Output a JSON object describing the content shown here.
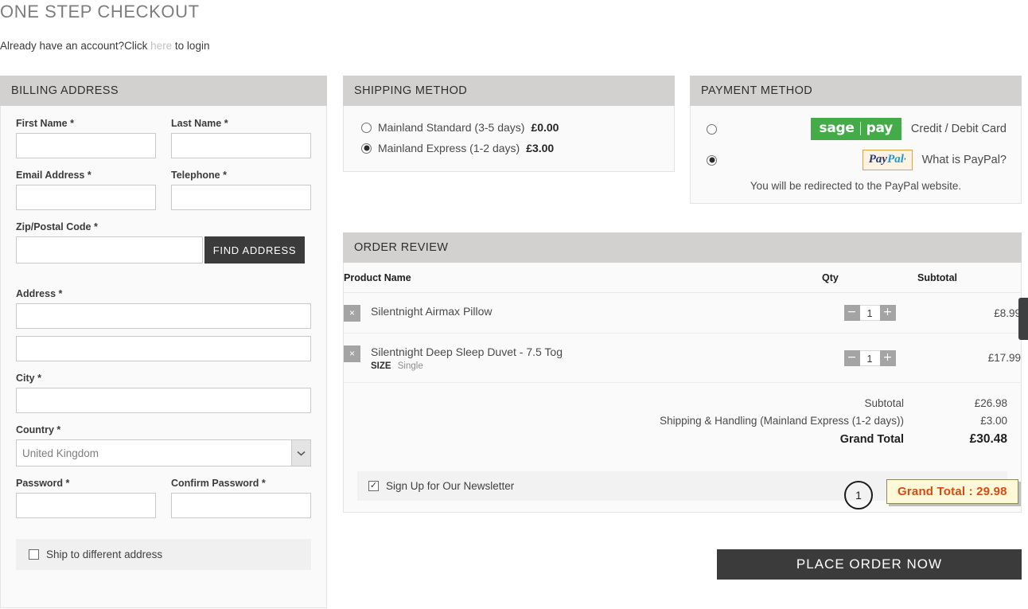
{
  "header": {
    "title": "ONE STEP CHECKOUT",
    "login_prefix": "Already have an account?Click",
    "login_link": "here",
    "login_suffix": "to login"
  },
  "billing": {
    "heading": "BILLING ADDRESS",
    "fields": {
      "first_name": {
        "label": "First Name",
        "required": "*",
        "value": ""
      },
      "last_name": {
        "label": "Last Name",
        "required": "*",
        "value": ""
      },
      "email": {
        "label": "Email Address",
        "required": "*",
        "value": ""
      },
      "telephone": {
        "label": "Telephone",
        "required": "*",
        "value": ""
      },
      "zip": {
        "label": "Zip/Postal Code",
        "required": "*",
        "value": ""
      },
      "address": {
        "label": "Address",
        "required": "*",
        "value": "",
        "line2_value": ""
      },
      "city": {
        "label": "City",
        "required": "*",
        "value": ""
      },
      "country": {
        "label": "Country",
        "required": "*",
        "value": "United Kingdom"
      },
      "password": {
        "label": "Password",
        "required": "*",
        "value": ""
      },
      "confirm_password": {
        "label": "Confirm Password",
        "required": "*",
        "value": ""
      }
    },
    "find_address_label": "FIND ADDRESS",
    "ship_to_different": {
      "label": "Ship to different address",
      "checked": false
    }
  },
  "shipping": {
    "heading": "SHIPPING METHOD",
    "options": [
      {
        "label": "Mainland Standard (3-5 days)",
        "price": "£0.00",
        "selected": false
      },
      {
        "label": "Mainland Express (1-2 days)",
        "price": "£3.00",
        "selected": true
      }
    ]
  },
  "payment": {
    "heading": "PAYMENT METHOD",
    "options": [
      {
        "logo": "sagepay-logo",
        "logo_left": "sage",
        "logo_right": "pay",
        "label": "Credit / Debit Card",
        "selected": false
      },
      {
        "logo": "paypal-logo",
        "logo_left": "Pay",
        "logo_right": "Pal",
        "label": "What is PayPal?",
        "selected": true
      }
    ],
    "redirect_note": "You will be redirected to the PayPal website."
  },
  "order_review": {
    "heading": "ORDER REVIEW",
    "columns": {
      "name": "Product Name",
      "qty": "Qty",
      "subtotal": "Subtotal"
    },
    "items": [
      {
        "name": "Silentnight Airmax Pillow",
        "option_label": "",
        "option_value": "",
        "qty": "1",
        "subtotal": "£8.99",
        "remove": "×",
        "minus": "−",
        "plus": "+"
      },
      {
        "name": "Silentnight Deep Sleep Duvet - 7.5 Tog",
        "option_label": "SIZE",
        "option_value": "Single",
        "qty": "1",
        "subtotal": "£17.99",
        "remove": "×",
        "minus": "−",
        "plus": "+"
      }
    ],
    "totals": [
      {
        "label": "Subtotal",
        "value": "£26.98",
        "grand": false
      },
      {
        "label": "Shipping & Handling (Mainland Express (1-2 days))",
        "value": "£3.00",
        "grand": false
      },
      {
        "label": "Grand Total",
        "value": "£30.48",
        "grand": true
      }
    ],
    "newsletter": {
      "label": "Sign Up for Our Newsletter",
      "checked": true
    }
  },
  "place_order_label": "PLACE ORDER NOW",
  "annotation": {
    "marker": "1",
    "text": "Grand Total : 29.98",
    "color": "#d94a12",
    "background": "#fdf8d8"
  }
}
